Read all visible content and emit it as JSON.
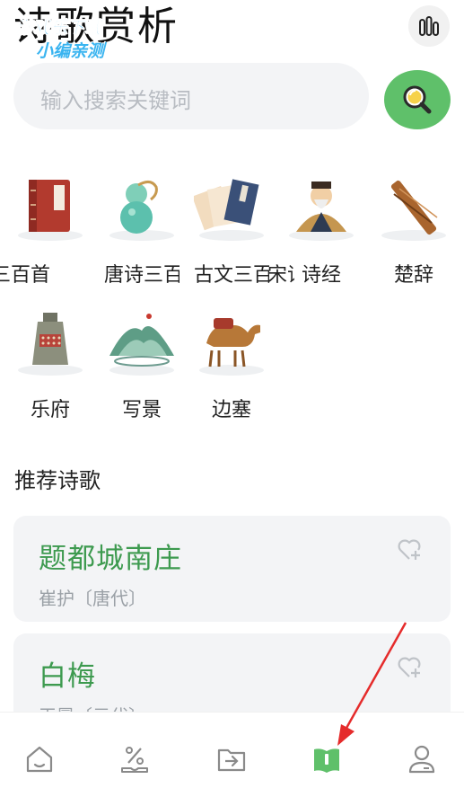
{
  "header": {
    "title": "诗歌赏析"
  },
  "watermark": {
    "line1": "游戏乐下载",
    "line2": "小编亲测"
  },
  "search": {
    "placeholder": "输入搜索关键词"
  },
  "categories": [
    {
      "label": "三百首",
      "icon": "red-book-icon"
    },
    {
      "label": "唐诗三百首",
      "icon": "gourd-icon"
    },
    {
      "label": "古文三百首",
      "icon": "papers-icon"
    },
    {
      "label": "宋词",
      "icon": "confucius-icon"
    },
    {
      "label": "诗经",
      "icon": "poet-icon"
    },
    {
      "label": "楚辞",
      "icon": "bamboo-scroll-icon"
    },
    {
      "label": "乐府",
      "icon": "bell-icon"
    },
    {
      "label": "写景",
      "icon": "landscape-icon"
    },
    {
      "label": "边塞",
      "icon": "camel-icon"
    }
  ],
  "recommend": {
    "title": "推荐诗歌",
    "poems": [
      {
        "title": "题都城南庄",
        "author": "崔护〔唐代〕"
      },
      {
        "title": "白梅",
        "author": "王冕〔元代〕"
      }
    ]
  },
  "nav": {
    "items": [
      "home-icon",
      "discount-icon",
      "export-icon",
      "book-icon",
      "profile-icon"
    ],
    "active_index": 3
  },
  "colors": {
    "accent": "#5fc06a",
    "poem_title": "#3d9a4f",
    "arrow": "#e52b2b"
  }
}
